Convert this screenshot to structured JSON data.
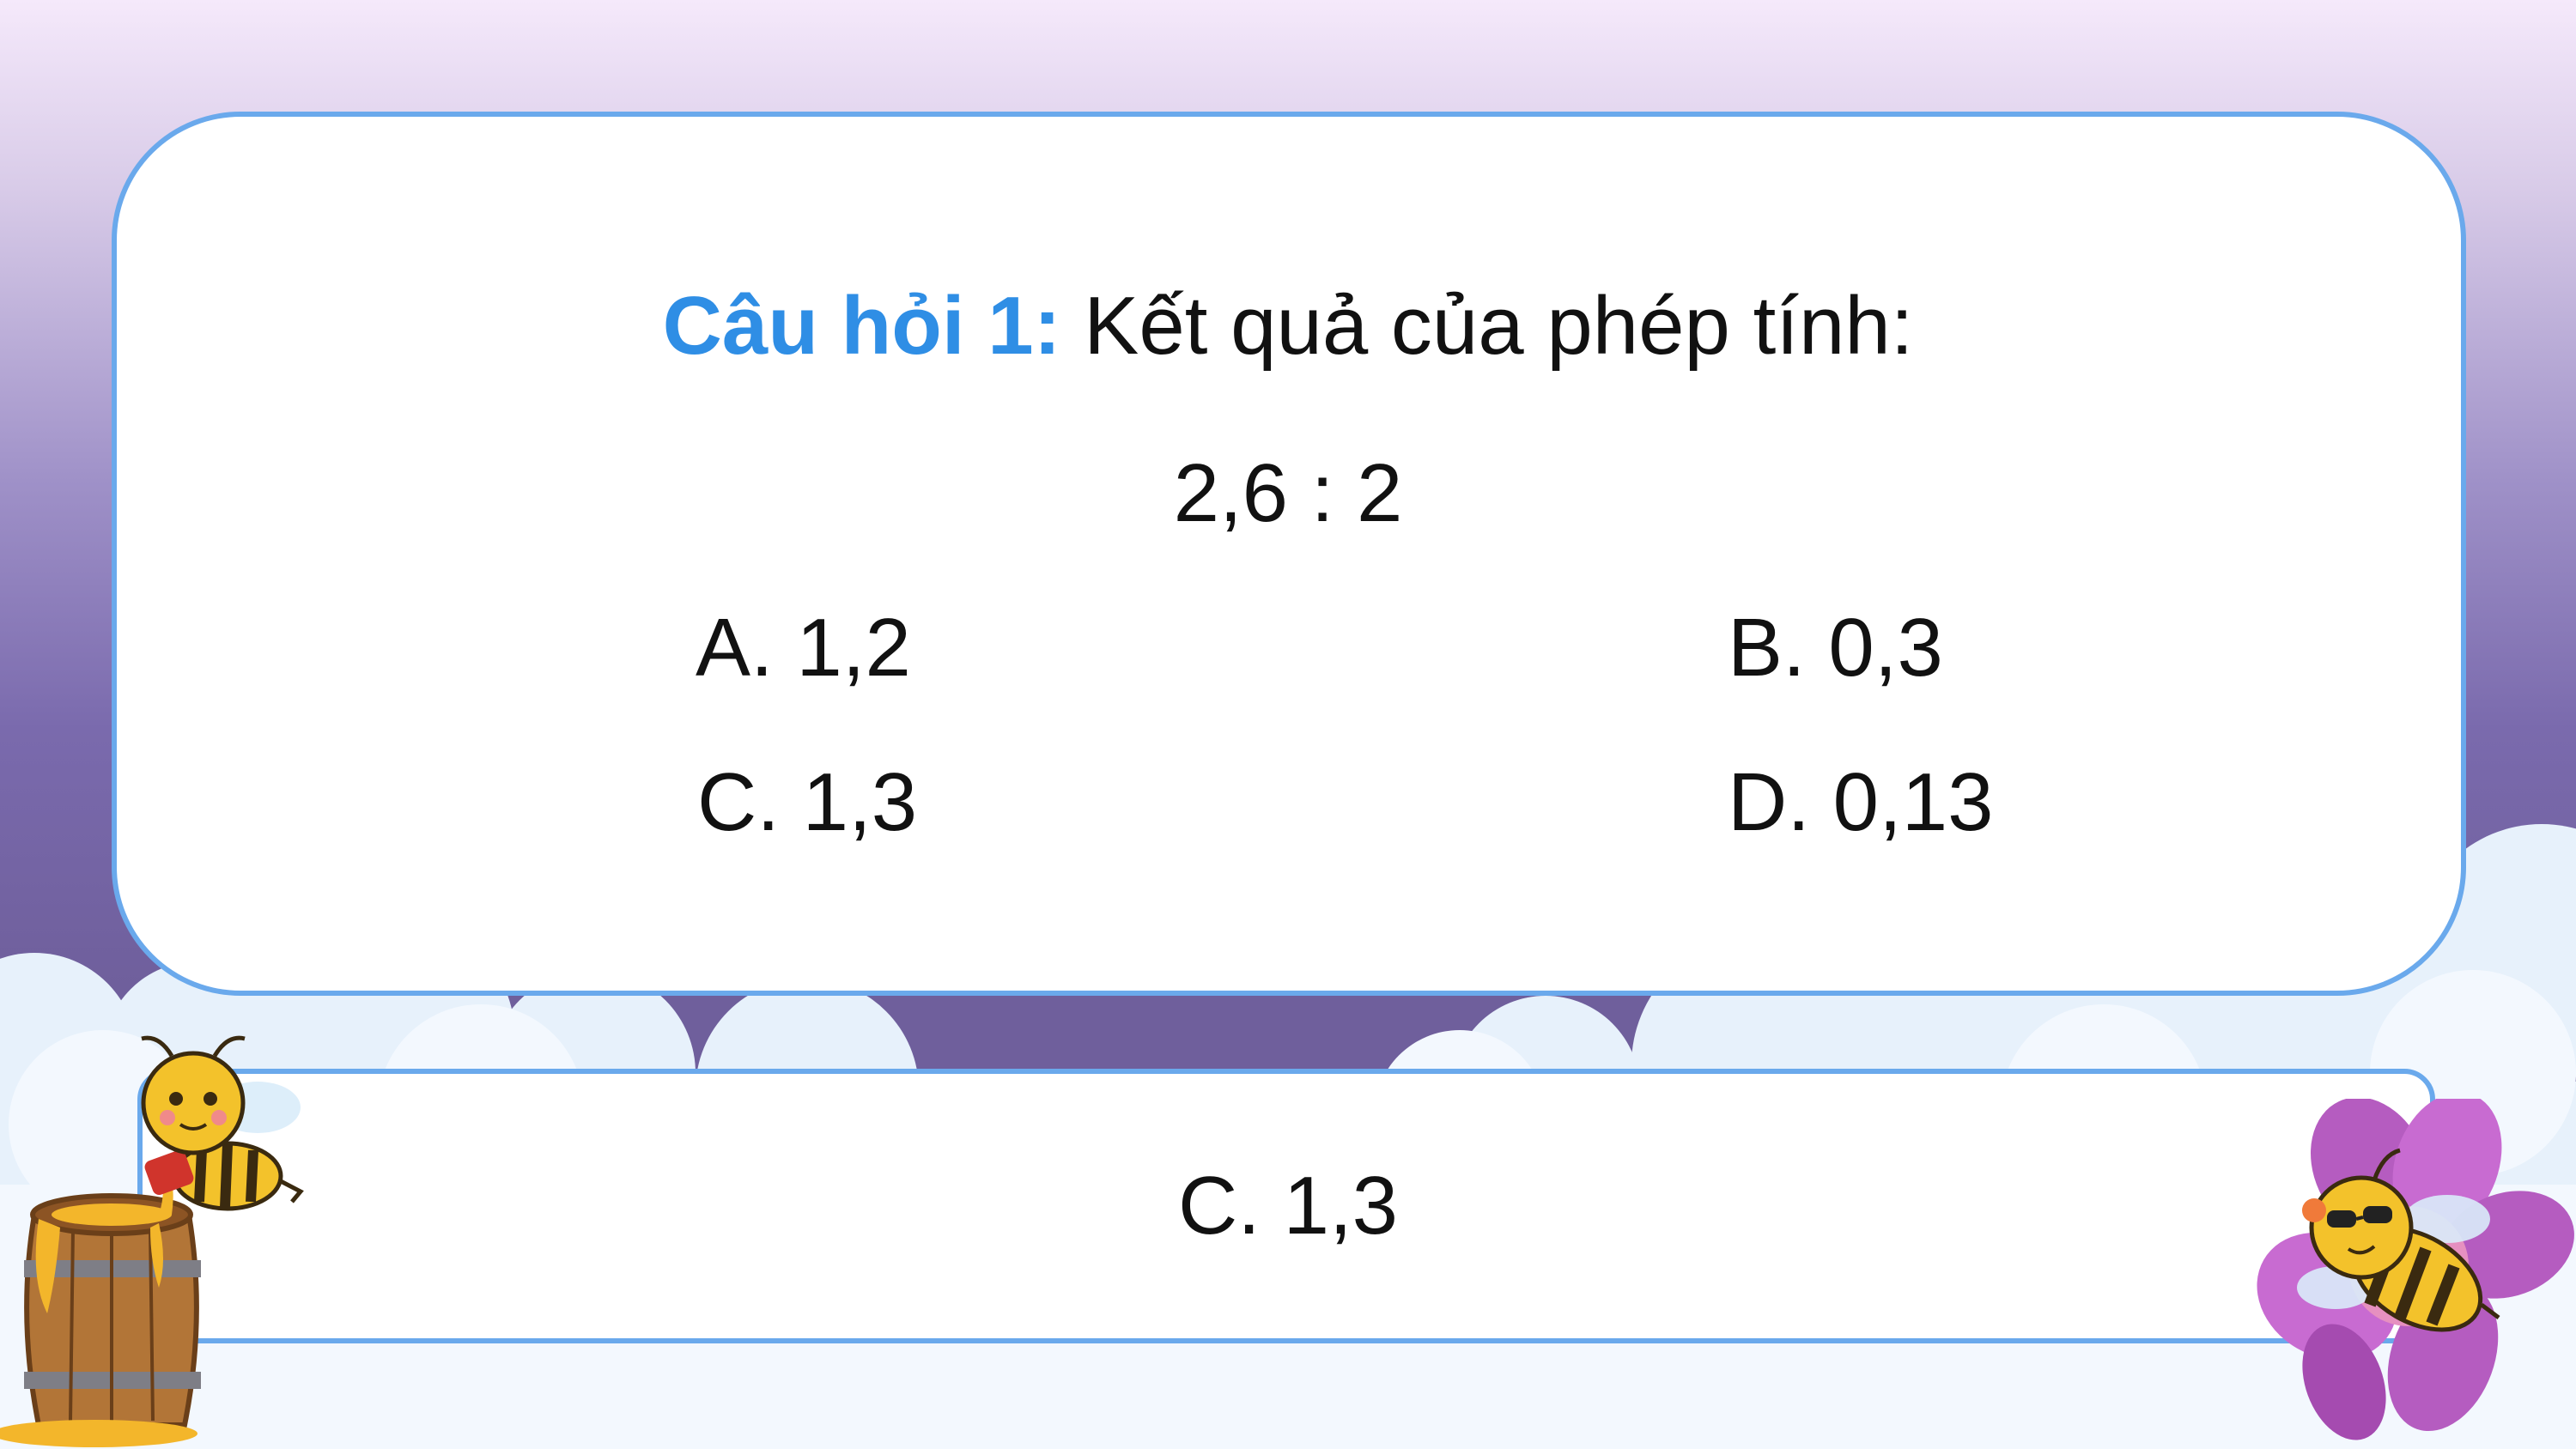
{
  "question": {
    "label": "Câu hỏi 1:",
    "text": " Kết quả của phép tính:",
    "expression": "2,6 : 2"
  },
  "options": [
    {
      "text": "A. 1,2"
    },
    {
      "text": "B. 0,3"
    },
    {
      "text": "C. 1,3"
    },
    {
      "text": "D. 0,13"
    }
  ],
  "answer": {
    "text": "C. 1,3"
  },
  "colors": {
    "label": "#2f8ee5",
    "panel_border": "#6aa9ec",
    "background_top": "#f5e9fb",
    "background_bottom": "#6f5f9c"
  },
  "decorations": {
    "left": [
      "bee-icon",
      "honey-barrel-icon"
    ],
    "right": [
      "bee-icon",
      "flower-icon"
    ]
  }
}
